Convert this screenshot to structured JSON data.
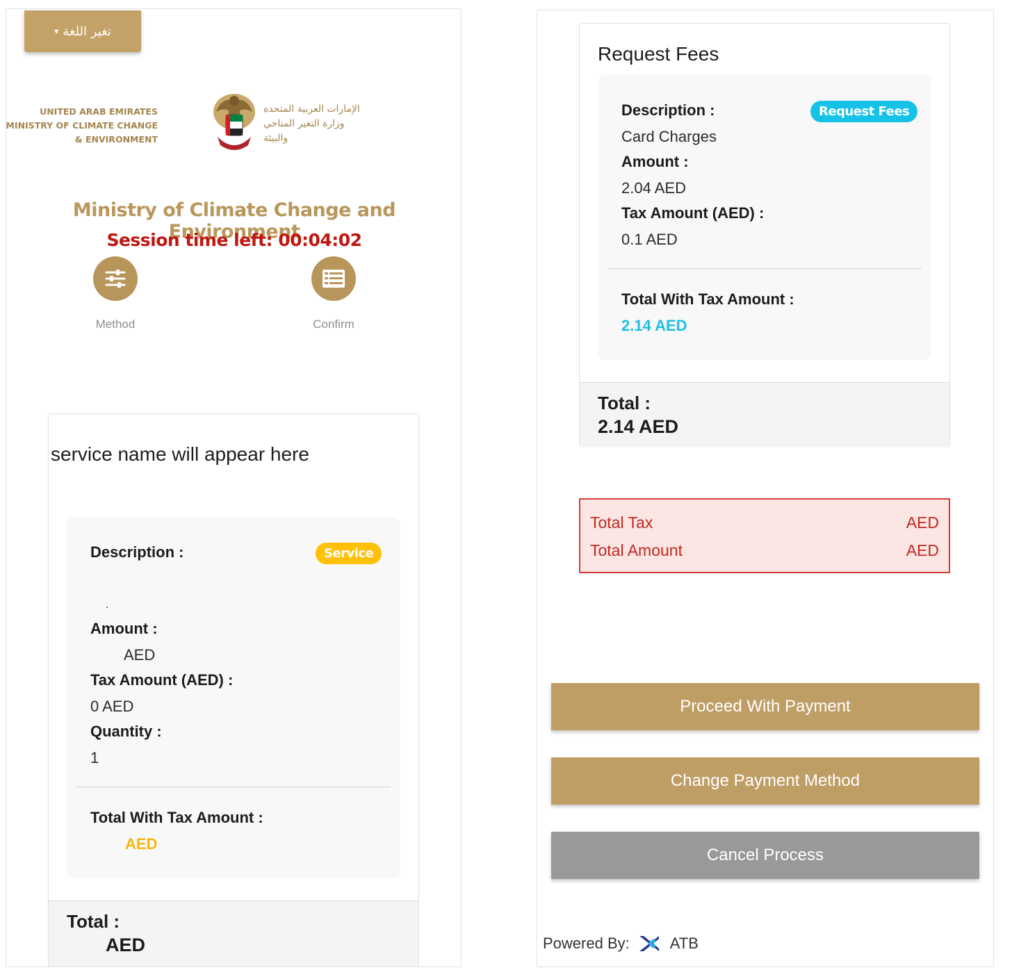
{
  "left_panel": {
    "language_button": {
      "label": "تغير اللغة",
      "caret": "▾"
    },
    "logo": {
      "english_lines": [
        "UNITED ARAB EMIRATES",
        "MINISTRY OF CLIMATE CHANGE",
        "& ENVIRONMENT"
      ],
      "arabic_lines": [
        "الإمارات العربية المتحدة",
        "وزارة التغير المناخي",
        "والبيئة"
      ],
      "emblem_icon": "uae-falcon-emblem"
    },
    "ministry_title": "Ministry of Climate Change and Environment",
    "session_timer": "Session time left: 00:04:02",
    "steps": [
      {
        "label": "Method",
        "icon": "sliders-icon"
      },
      {
        "label": "Confirm",
        "icon": "list-icon"
      }
    ],
    "service_card": {
      "service_name": "service name will appear here",
      "badge": "Service",
      "description_label": "Description :",
      "description_value": ".",
      "amount_label": "Amount :",
      "amount_value": "AED",
      "tax_label": "Tax Amount (AED) :",
      "tax_value": "0 AED",
      "quantity_label": "Quantity :",
      "quantity_value": "1",
      "total_with_tax_label": "Total With Tax Amount :",
      "total_with_tax_value": "AED",
      "total_label": "Total :",
      "total_value": "AED"
    }
  },
  "right_panel": {
    "fees_card": {
      "title": "Request Fees",
      "badge": "Request Fees",
      "description_label": "Description :",
      "description_value": "Card Charges",
      "amount_label": "Amount :",
      "amount_value": "2.04 AED",
      "tax_label": "Tax Amount (AED) :",
      "tax_value": "0.1 AED",
      "total_with_tax_label": "Total With Tax Amount :",
      "total_with_tax_value": "2.14 AED",
      "total_label": "Total :",
      "total_value": "2.14 AED"
    },
    "summary": {
      "total_tax_label": "Total Tax",
      "total_tax_value": "AED",
      "total_amount_label": "Total Amount",
      "total_amount_value": "AED"
    },
    "buttons": {
      "proceed": "Proceed With Payment",
      "change": "Change Payment Method",
      "cancel": "Cancel Process"
    },
    "footer": {
      "powered_by": "Powered By:",
      "brand": "ATB",
      "brand_icon": "atb-logo-icon"
    }
  },
  "colors": {
    "gold": "#bf9e66",
    "title_gold": "#b9975b",
    "session_red": "#c0160f",
    "service_badge": "#ffc107",
    "fees_badge": "#17c2e8",
    "summary_border": "#d63a36",
    "summary_bg": "#fbe6e4",
    "cancel_gray": "#999999"
  }
}
